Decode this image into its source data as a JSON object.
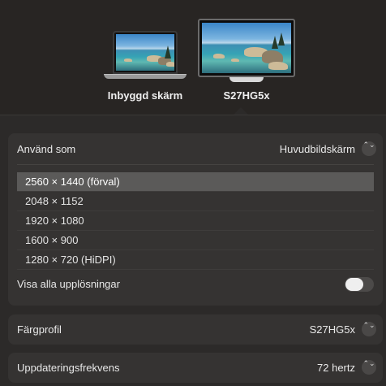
{
  "displays": {
    "builtin": {
      "name": "Inbyggd skärm",
      "icon": "laptop-icon"
    },
    "external": {
      "name": "S27HG5x",
      "icon": "monitor-icon",
      "selected": true
    }
  },
  "use_as": {
    "label": "Använd som",
    "value": "Huvudbildskärm"
  },
  "resolutions": [
    {
      "label": "2560 × 1440 (förval)",
      "selected": true
    },
    {
      "label": "2048 × 1152",
      "selected": false
    },
    {
      "label": "1920 × 1080",
      "selected": false
    },
    {
      "label": "1600 × 900",
      "selected": false
    },
    {
      "label": "1280 × 720 (HiDPI)",
      "selected": false
    }
  ],
  "show_all": {
    "label": "Visa alla upplösningar",
    "enabled": false
  },
  "color_profile": {
    "label": "Färgprofil",
    "value": "S27HG5x"
  },
  "refresh_rate": {
    "label": "Uppdateringsfrekvens",
    "value": "72 hertz"
  },
  "stepper_glyph": "⌃⌄"
}
